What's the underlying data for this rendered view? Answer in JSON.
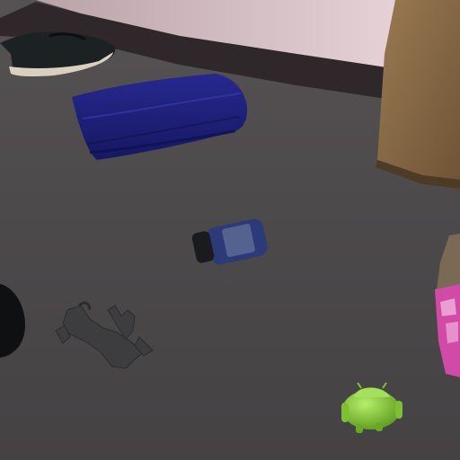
{
  "scene": {
    "description_free": true,
    "objects": [
      {
        "name": "shoe",
        "color": "#1f2426"
      },
      {
        "name": "folded-towel",
        "color": "#1c1f78"
      },
      {
        "name": "pill-bottle",
        "color": "#2b3a7a"
      },
      {
        "name": "toy-figure",
        "color": "#3a3a3d"
      },
      {
        "name": "android-robot-toy",
        "color": "#8fd23a"
      },
      {
        "name": "pink-box",
        "color": "#d24aa8"
      },
      {
        "name": "wooden-cabinet",
        "color": "#8a6a45"
      },
      {
        "name": "black-bag",
        "color": "#111214"
      }
    ],
    "colors": {
      "carpet": "#4d4a4c",
      "wall": "#d8c3c9",
      "baseboard": "#3b2f32"
    }
  }
}
